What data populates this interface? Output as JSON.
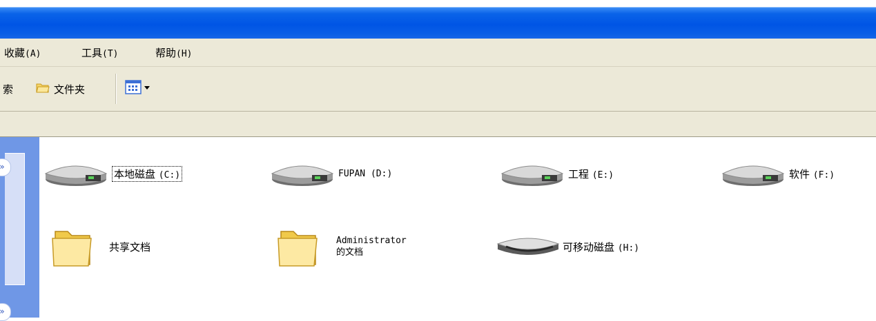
{
  "menubar": {
    "items": [
      {
        "label": "收藏",
        "key": "(A)"
      },
      {
        "label": "工具",
        "key": "(T)"
      },
      {
        "label": "帮助",
        "key": "(H)"
      }
    ]
  },
  "toolbar": {
    "search_label": "索",
    "folders_label": "文件夹",
    "views_icon": "views-icon"
  },
  "drives": [
    {
      "name": "本地磁盘",
      "letter": "(C:)",
      "icon": "hard-drive-icon"
    },
    {
      "name": "FUPAN",
      "letter": "(D:)",
      "icon": "hard-drive-icon"
    },
    {
      "name": "工程",
      "letter": "(E:)",
      "icon": "hard-drive-icon"
    },
    {
      "name": "软件",
      "letter": "(F:)",
      "icon": "hard-drive-icon"
    }
  ],
  "folders": [
    {
      "label": "共享文档",
      "icon": "folder-icon"
    },
    {
      "label": "Administrator 的文档",
      "icon": "folder-icon"
    }
  ],
  "removable": {
    "name": "可移动磁盘",
    "letter": "(H:)",
    "icon": "removable-drive-icon"
  },
  "colors": {
    "title_bar": "#0055e5",
    "chrome": "#ece9d8",
    "task_pane": "#6f97e6"
  }
}
